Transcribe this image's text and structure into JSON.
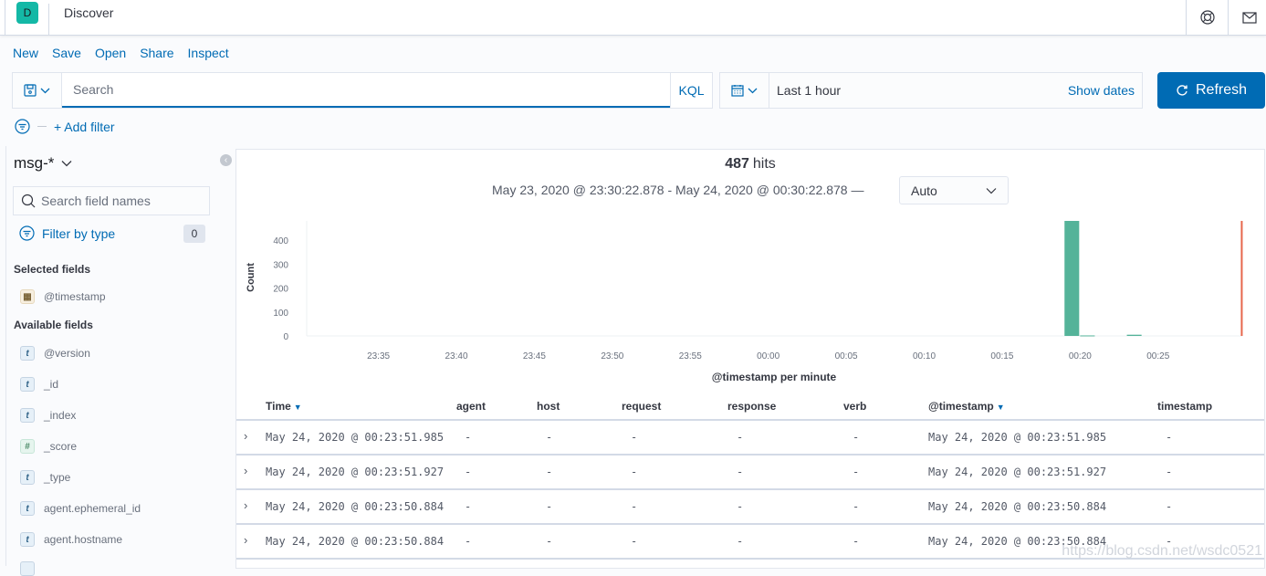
{
  "header": {
    "avatar_letter": "D",
    "app_title": "Discover",
    "icons": [
      "help-icon",
      "mail-icon"
    ]
  },
  "menu": [
    "New",
    "Save",
    "Open",
    "Share",
    "Inspect"
  ],
  "query": {
    "placeholder": "Search",
    "value": "",
    "language": "KQL"
  },
  "time": {
    "label": "Last 1 hour",
    "show_dates": "Show dates",
    "refresh": "Refresh"
  },
  "filters": {
    "add_filter": "+ Add filter"
  },
  "sidebar": {
    "index_pattern": "msg-*",
    "search_placeholder": "Search field names",
    "filter_by_type": "Filter by type",
    "filter_count": "0",
    "selected_title": "Selected fields",
    "selected_fields": [
      {
        "name": "@timestamp",
        "type": "date"
      }
    ],
    "available_title": "Available fields",
    "available_fields": [
      {
        "name": "@version",
        "type": "t"
      },
      {
        "name": "_id",
        "type": "t"
      },
      {
        "name": "_index",
        "type": "t"
      },
      {
        "name": "_score",
        "type": "#"
      },
      {
        "name": "_type",
        "type": "t"
      },
      {
        "name": "agent.ephemeral_id",
        "type": "t"
      },
      {
        "name": "agent.hostname",
        "type": "t"
      }
    ]
  },
  "summary": {
    "hits_count": "487",
    "hits_label": "hits",
    "range": "May 23, 2020 @ 23:30:22.878 - May 24, 2020 @ 00:30:22.878 —",
    "interval": "Auto"
  },
  "chart_data": {
    "type": "bar",
    "title": "",
    "xlabel": "@timestamp per minute",
    "ylabel": "Count",
    "ylim": [
      0,
      480
    ],
    "yticks": [
      0,
      100,
      200,
      300,
      400
    ],
    "xticks": [
      "23:35",
      "23:40",
      "23:45",
      "23:50",
      "23:55",
      "00:00",
      "00:05",
      "00:10",
      "00:15",
      "00:20",
      "00:25"
    ],
    "x_range_minutes": [
      -29.6,
      30.4
    ],
    "bars": [
      {
        "x": "00:19",
        "offset_min": 19,
        "value": 480
      },
      {
        "x": "00:20",
        "offset_min": 20,
        "value": 2
      },
      {
        "x": "00:23",
        "offset_min": 23,
        "value": 5
      }
    ],
    "now_marker": "00:30:22",
    "colors": {
      "bar": "#54b399",
      "now_line": "#e7664c"
    }
  },
  "table": {
    "columns": [
      {
        "label": "Time",
        "sorted": true
      },
      {
        "label": "agent"
      },
      {
        "label": "host"
      },
      {
        "label": "request"
      },
      {
        "label": "response"
      },
      {
        "label": "verb"
      },
      {
        "label": "@timestamp",
        "sorted": true
      },
      {
        "label": "timestamp"
      }
    ],
    "rows": [
      [
        "May 24, 2020 @ 00:23:51.985",
        "-",
        "-",
        "-",
        "-",
        "-",
        "May 24, 2020 @ 00:23:51.985",
        "-"
      ],
      [
        "May 24, 2020 @ 00:23:51.927",
        "-",
        "-",
        "-",
        "-",
        "-",
        "May 24, 2020 @ 00:23:51.927",
        "-"
      ],
      [
        "May 24, 2020 @ 00:23:50.884",
        "-",
        "-",
        "-",
        "-",
        "-",
        "May 24, 2020 @ 00:23:50.884",
        "-"
      ],
      [
        "May 24, 2020 @ 00:23:50.884",
        "-",
        "-",
        "-",
        "-",
        "-",
        "May 24, 2020 @ 00:23:50.884",
        "-"
      ]
    ]
  },
  "watermark": "https://blog.csdn.net/wsdc0521"
}
